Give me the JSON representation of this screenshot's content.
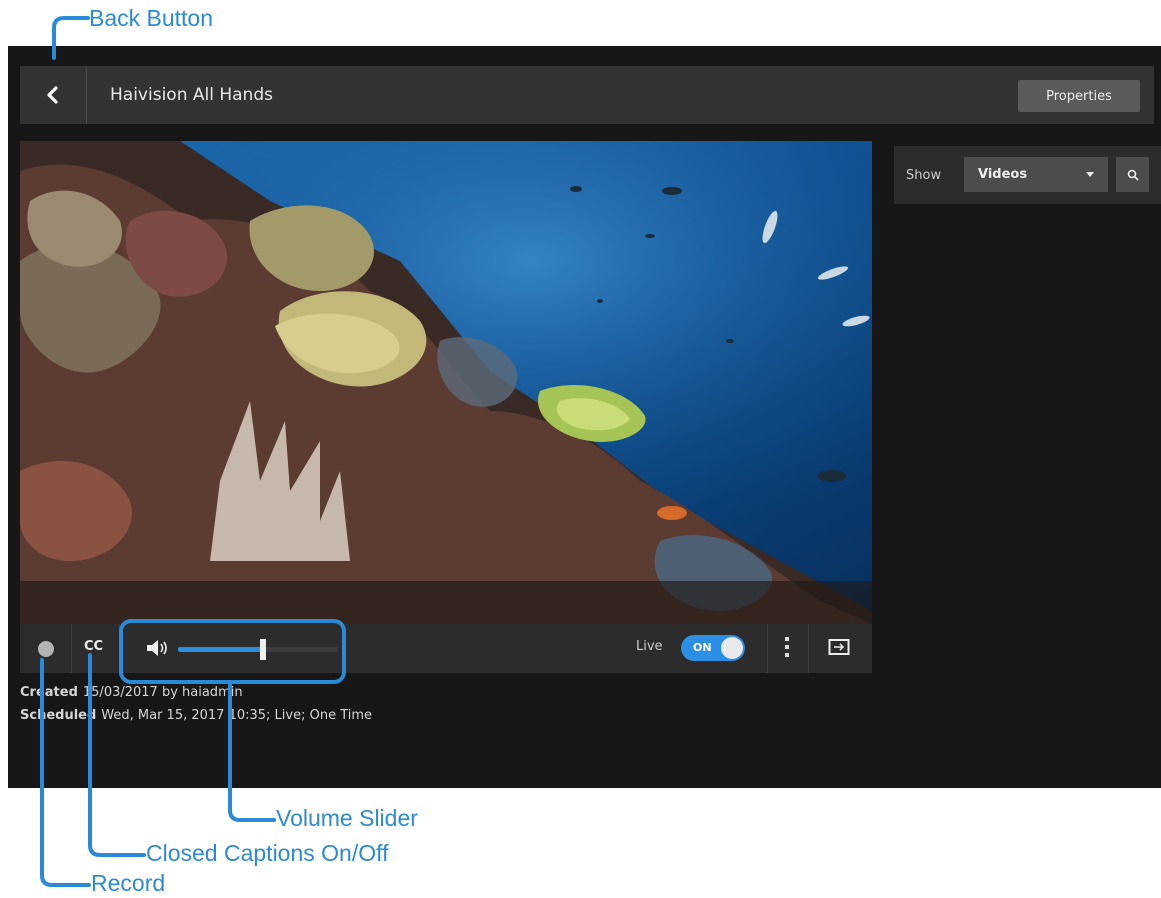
{
  "app": {
    "title": "Haivision All Hands",
    "properties_label": "Properties"
  },
  "player": {
    "cc_label": "CC",
    "volume_level": 0.53,
    "live_label": "Live",
    "live_toggle_label": "ON",
    "live_on": true
  },
  "details": {
    "created_label": "Created",
    "created_value": "15/03/2017 by haiadmin",
    "scheduled_label": "Scheduled",
    "scheduled_value": "Wed, Mar 15, 2017 10:35; Live; One Time"
  },
  "sidebar": {
    "show_label": "Show",
    "show_value": "Videos"
  },
  "annotations": {
    "back_button": "Back Button",
    "volume_slider": "Volume Slider",
    "closed_captions": "Closed Captions On/Off",
    "record": "Record"
  },
  "colors": {
    "accent": "#2a8fe5",
    "annotation": "#2a8ad8",
    "background": "#171717",
    "bar": "#333333"
  },
  "icons": {
    "back": "chevron-left-icon",
    "record": "record-dot-icon",
    "volume": "speaker-icon",
    "more": "vertical-dots-icon",
    "theater": "theater-mode-icon",
    "search": "magnifier-icon"
  }
}
